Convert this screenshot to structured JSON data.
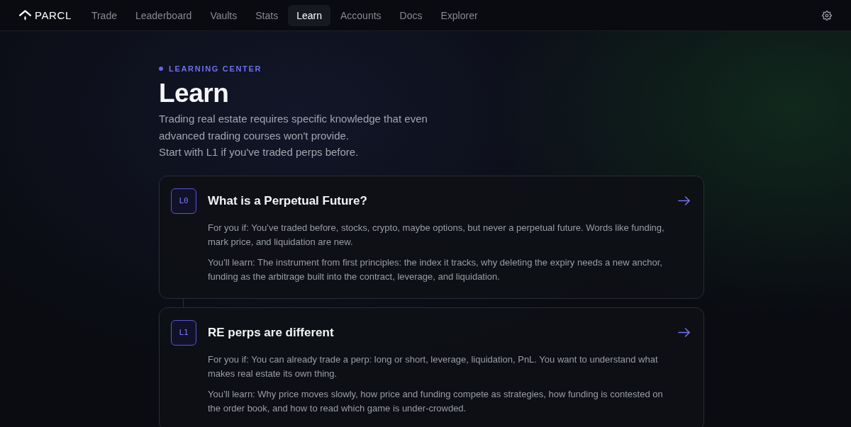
{
  "brand": {
    "name": "PARCL"
  },
  "nav": {
    "items": [
      {
        "label": "Trade",
        "selected": false
      },
      {
        "label": "Leaderboard",
        "selected": false
      },
      {
        "label": "Vaults",
        "selected": false
      },
      {
        "label": "Stats",
        "selected": false
      },
      {
        "label": "Learn",
        "selected": true
      },
      {
        "label": "Accounts",
        "selected": false
      },
      {
        "label": "Docs",
        "selected": false
      },
      {
        "label": "Explorer",
        "selected": false
      }
    ]
  },
  "header": {
    "eyebrow": "LEARNING CENTER",
    "title": "Learn",
    "intro": "Trading real estate requires specific knowledge that even advanced trading courses won't provide.",
    "note": "Start with L1 if you've traded perps before."
  },
  "courses": [
    {
      "level": "L0",
      "title": "What is a Perpetual Future?",
      "audience": "For you if: You’ve traded before, stocks, crypto, maybe options, but never a perpetual future. Words like funding, mark price, and liquidation are new.",
      "outcome": "You’ll learn: The instrument from first principles: the index it tracks, why deleting the expiry needs a new anchor, funding as the arbitrage built into the contract, leverage, and liquidation."
    },
    {
      "level": "L1",
      "title": "RE perps are different",
      "audience": "For you if: You can already trade a perp: long or short, leverage, liquidation, PnL. You want to understand what makes real estate its own thing.",
      "outcome": "You’ll learn: Why price moves slowly, how price and funding compete as strategies, how funding is contested on the order book, and how to read which game is under-crowded."
    }
  ]
}
